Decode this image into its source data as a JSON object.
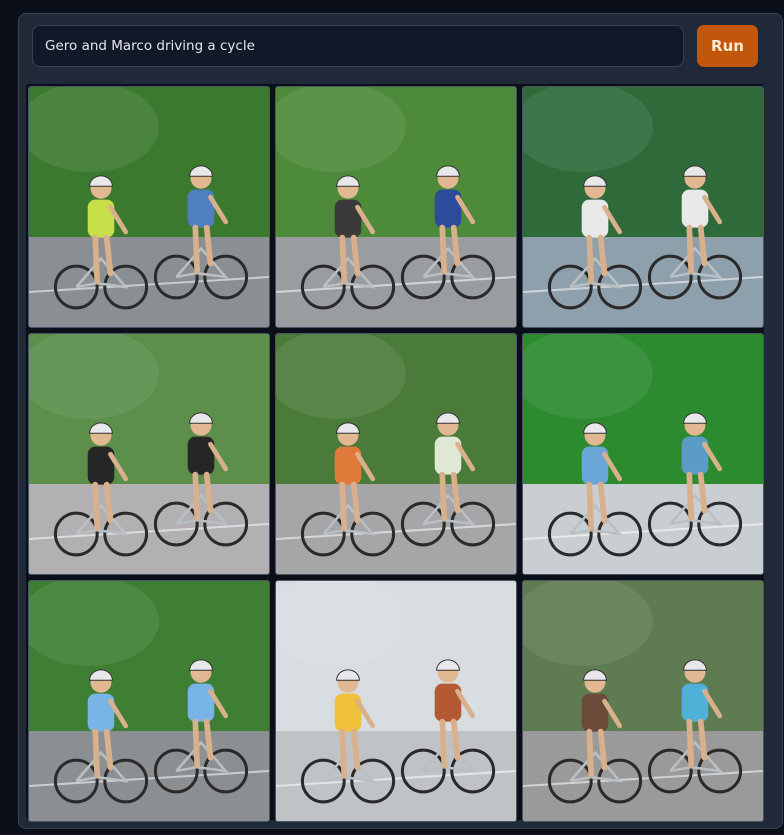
{
  "prompt": {
    "value": "Gero and Marco driving a cycle"
  },
  "run_button": {
    "label": "Run",
    "color": "#c2570c"
  },
  "gallery": {
    "images": [
      {
        "name": "gallery-image-1",
        "bg": "#3b7a2e",
        "ground": "#8a8f93",
        "rider1": "#c7e04a",
        "rider2": "#4f7fc0"
      },
      {
        "name": "gallery-image-2",
        "bg": "#4d8a3a",
        "ground": "#9a9da0",
        "rider1": "#3a3a3a",
        "rider2": "#2c4b9b"
      },
      {
        "name": "gallery-image-3",
        "bg": "#2f6b3a",
        "ground": "#8fa0ad",
        "rider1": "#e9e9ea",
        "rider2": "#e9e9ea"
      },
      {
        "name": "gallery-image-4",
        "bg": "#5b8f4a",
        "ground": "#b2b0b3",
        "rider1": "#262626",
        "rider2": "#262626"
      },
      {
        "name": "gallery-image-5",
        "bg": "#4b7b3a",
        "ground": "#a6a5a8",
        "rider1": "#e07a3a",
        "rider2": "#dfe8d4"
      },
      {
        "name": "gallery-image-6",
        "bg": "#2c8a2f",
        "ground": "#c9ced2",
        "rider1": "#6aa6d6",
        "rider2": "#5a9cc6"
      },
      {
        "name": "gallery-image-7",
        "bg": "#3f7f34",
        "ground": "#8c8f92",
        "rider1": "#79b4e6",
        "rider2": "#79b4e6"
      },
      {
        "name": "gallery-image-8",
        "bg": "#d8dde2",
        "ground": "#c0c3c6",
        "rider1": "#f0c23c",
        "rider2": "#b35a35"
      },
      {
        "name": "gallery-image-9",
        "bg": "#5f7b52",
        "ground": "#9a9a9a",
        "rider1": "#6b4a3a",
        "rider2": "#4fb0d8"
      }
    ]
  }
}
